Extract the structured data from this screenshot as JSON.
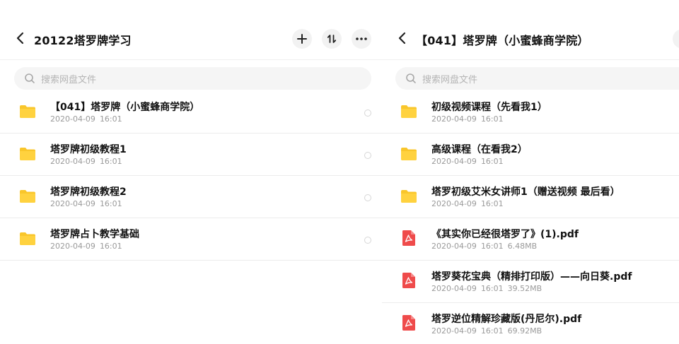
{
  "left_panel": {
    "title": "20122塔罗牌学习",
    "buttons": [
      "add-icon",
      "sort-icon",
      "more-icon"
    ],
    "search_placeholder": "搜索网盘文件",
    "items": [
      {
        "name": "【041】塔罗牌（小蜜蜂商学院）",
        "date": "2020-04-09",
        "time": "16:01",
        "type": "folder"
      },
      {
        "name": "塔罗牌初级教程1",
        "date": "2020-04-09",
        "time": "16:01",
        "type": "folder"
      },
      {
        "name": "塔罗牌初级教程2",
        "date": "2020-04-09",
        "time": "16:01",
        "type": "folder"
      },
      {
        "name": "塔罗牌占卜教学基础",
        "date": "2020-04-09",
        "time": "16:01",
        "type": "folder"
      }
    ]
  },
  "right_panel": {
    "title": "【041】塔罗牌（小蜜蜂商学院）",
    "search_placeholder": "搜索网盘文件",
    "items": [
      {
        "name": "初级视频课程（先看我1）",
        "date": "2020-04-09",
        "time": "16:01",
        "size": "",
        "type": "folder"
      },
      {
        "name": "高级课程（在看我2）",
        "date": "2020-04-09",
        "time": "16:01",
        "size": "",
        "type": "folder"
      },
      {
        "name": "塔罗初级艾米女讲师1（赠送视频 最后看）",
        "date": "2020-04-09",
        "time": "16:01",
        "size": "",
        "type": "folder"
      },
      {
        "name": "《其实你已经很塔罗了》(1).pdf",
        "date": "2020-04-09",
        "time": "16:01",
        "size": "6.48MB",
        "type": "pdf"
      },
      {
        "name": "塔罗葵花宝典（精排打印版）——向日葵.pdf",
        "date": "2020-04-09",
        "time": "16:01",
        "size": "39.52MB",
        "type": "pdf"
      },
      {
        "name": "塔罗逆位精解珍藏版(丹尼尔).pdf",
        "date": "2020-04-09",
        "time": "16:01",
        "size": "69.92MB",
        "type": "pdf"
      }
    ]
  },
  "colors": {
    "folder": "#f9c62b",
    "pdf": "#ef4b4b",
    "search_bg": "#f5f5f5",
    "meta_text": "#9a9a9a"
  }
}
